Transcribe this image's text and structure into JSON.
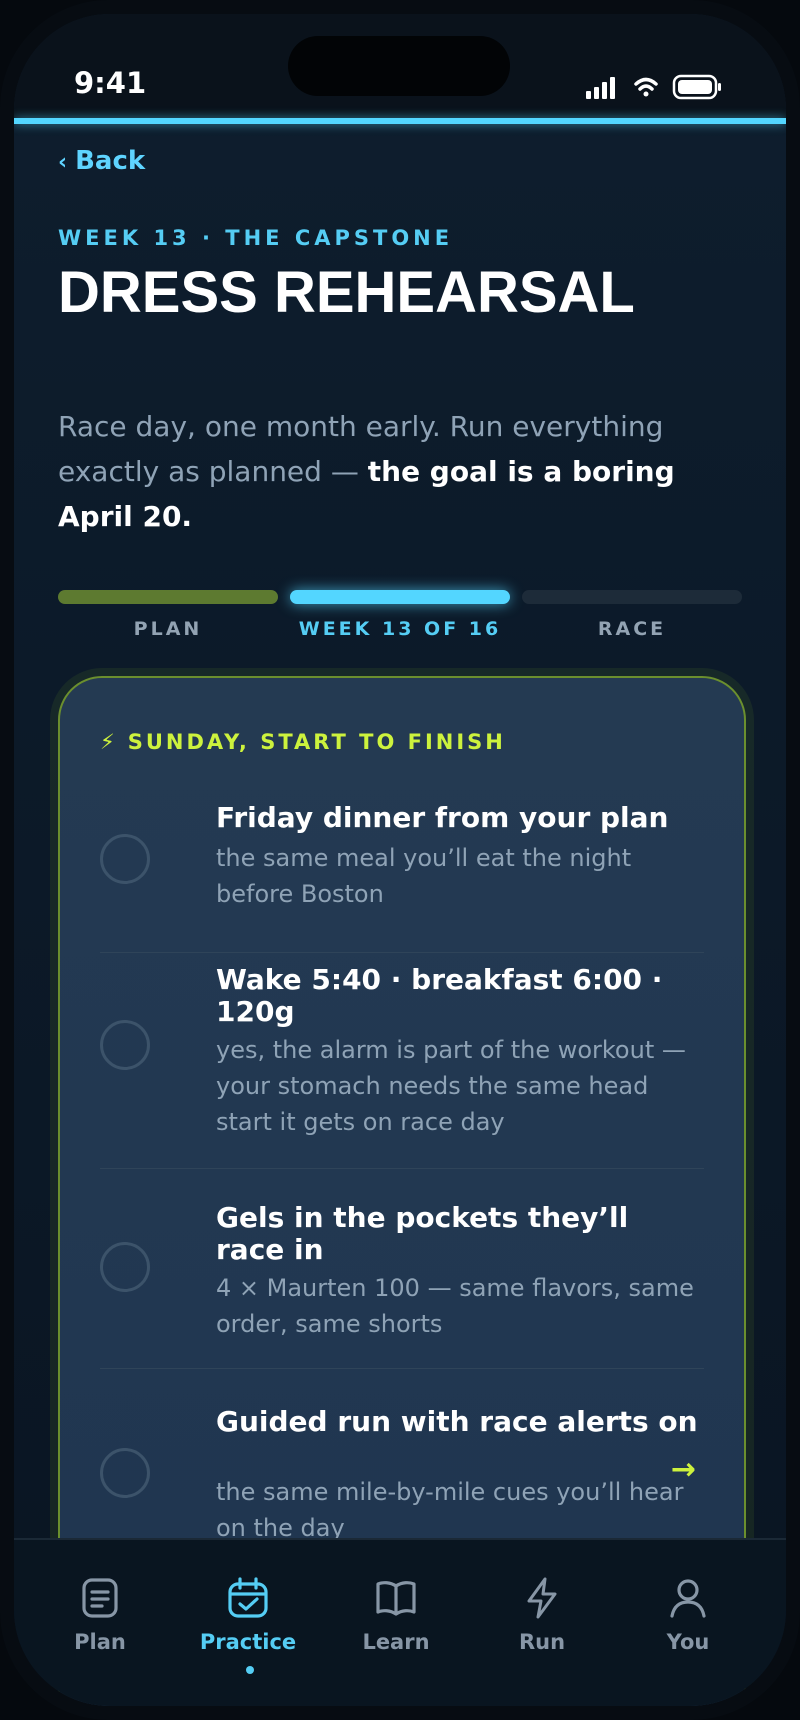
{
  "status": {
    "time": "9:41"
  },
  "header": {
    "back_label": "Back"
  },
  "hero": {
    "eyebrow": "WEEK 13 · THE CAPSTONE",
    "title": "DRESS REHEARSAL",
    "subtitle_plain": "Race day, one month early. Run everything exactly as planned — ",
    "subtitle_bold": "the goal is a boring April 20."
  },
  "progress": {
    "segments": [
      {
        "label": "PLAN"
      },
      {
        "label": "WEEK 13 OF 16"
      },
      {
        "label": "RACE"
      }
    ]
  },
  "card": {
    "heading": "SUNDAY, START TO FINISH",
    "heading_icon": "⚡",
    "items": [
      {
        "title": "Friday dinner from your plan",
        "desc": "the same meal you’ll eat the night before Boston"
      },
      {
        "title": "Wake 5:40 · breakfast 6:00 · 120g",
        "desc": "yes, the alarm is part of the workout — your stomach needs the same head start it gets on race day"
      },
      {
        "title": "Gels in the pockets they’ll race in",
        "desc": "4 × Maurten 100 — same flavors, same order, same shorts"
      },
      {
        "title": "Guided run with race alerts on",
        "desc": "the same mile-by-mile cues you’ll hear on the day"
      }
    ],
    "arrow": "→"
  },
  "nav": {
    "tabs": [
      {
        "label": "Plan",
        "icon": "document-icon"
      },
      {
        "label": "Practice",
        "icon": "calendar-check-icon",
        "active": true
      },
      {
        "label": "Learn",
        "icon": "book-icon"
      },
      {
        "label": "Run",
        "icon": "lightning-icon"
      },
      {
        "label": "You",
        "icon": "user-icon"
      }
    ]
  },
  "colors": {
    "accent": "#53d6ff",
    "highlight": "#cdf23d",
    "background": "#0e1e2e"
  }
}
